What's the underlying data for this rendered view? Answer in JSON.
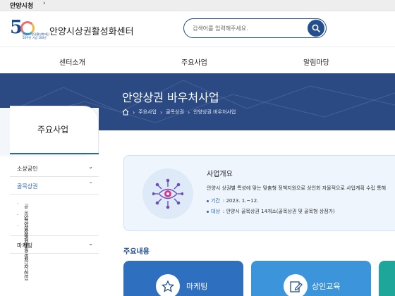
{
  "topbar": {
    "site_link": "안양시청",
    "caret": "›"
  },
  "header": {
    "logo_number": "5",
    "logo_tiny_1": "안양시 상권활성화재단",
    "logo_tiny_2": "50주년 기념 100년",
    "site_name": "안양시상권활성화센터",
    "search_placeholder": "검색어를 입력해주세요.",
    "search_icon": "search-icon"
  },
  "nav": {
    "items": [
      "센터소개",
      "주요사업",
      "알림마당"
    ]
  },
  "banner": {
    "title": "안양상권 바우처사업",
    "breadcrumb": [
      "주요사업",
      "골목상권",
      "안양상권 바우처사업"
    ],
    "home_icon": "home-icon",
    "separator": "›"
  },
  "sidebar": {
    "heading": "주요사업",
    "menu": [
      {
        "label": "소상공인",
        "caret": "⌄"
      },
      {
        "label": "골목상권",
        "caret": "⌃",
        "active": true,
        "sub": [
          "골목형상점가 지정",
          "안양상권 바우처사업",
          "골목상권 공모사업"
        ]
      },
      {
        "label": "마케팅",
        "caret": "⌄"
      }
    ]
  },
  "card": {
    "title": "사업개요",
    "description": "안양시 상권별 특성에 맞는 맞춤형 정책지원으로 상인회 자율적으로 사업계획 수립 통해",
    "period_label": "기간",
    "period_value": ": 2023. 1.~12.",
    "target_label": "대상",
    "target_value": ": 안양시 골목상권 14개소(골목상권 및 골목형 상점가)",
    "icon": "eye-network-icon"
  },
  "section": {
    "title": "주요내용"
  },
  "tiles": [
    {
      "label": "마케팅",
      "icon": "star-icon",
      "color": "#2e6fbf"
    },
    {
      "label": "상인교육",
      "icon": "edit-icon",
      "color": "#3c95da"
    },
    {
      "label": "",
      "icon": "",
      "color": "#1ea69a"
    }
  ],
  "colors": {
    "primary": "#2b4a84",
    "accent": "#2b62b8"
  }
}
